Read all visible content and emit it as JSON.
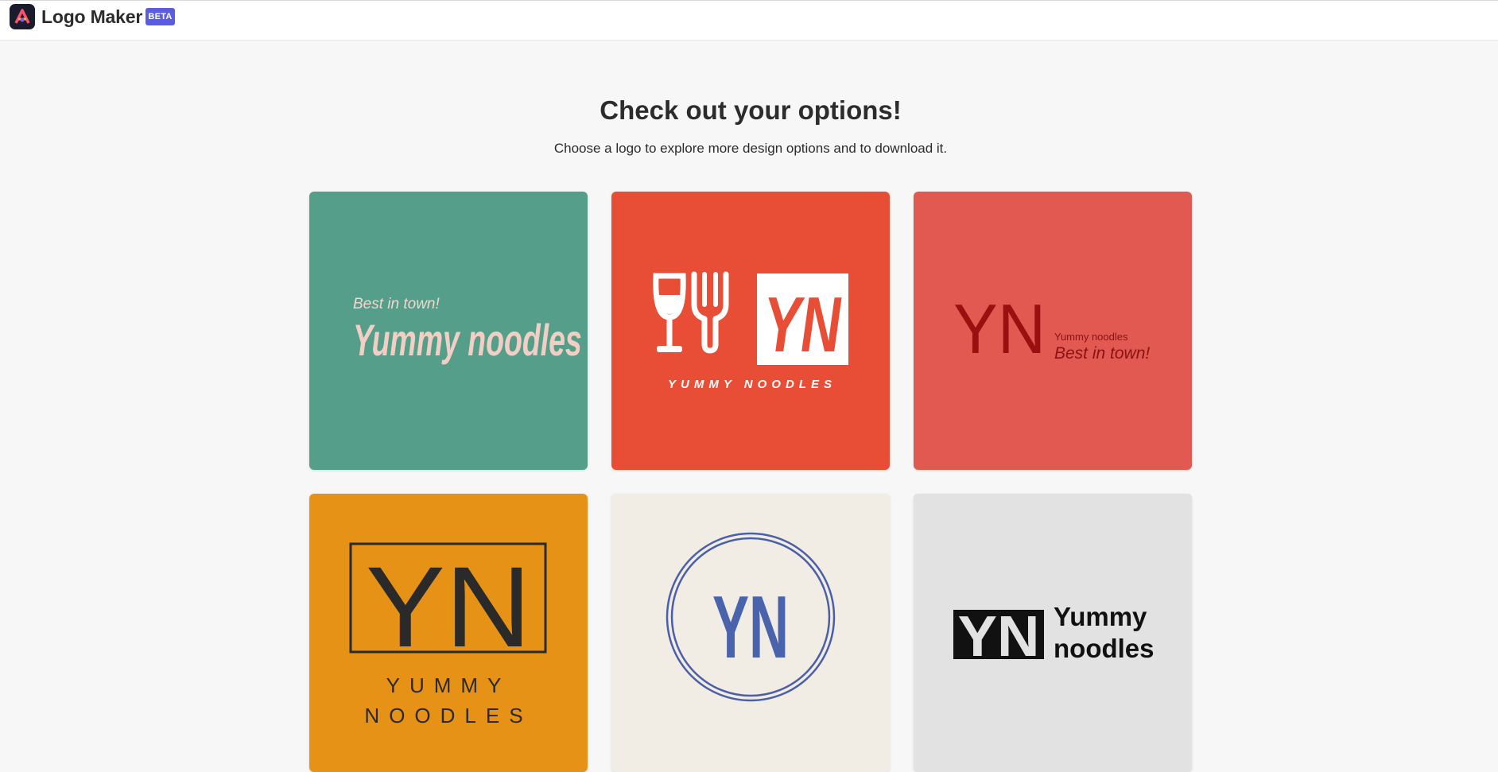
{
  "header": {
    "app_name": "Logo Maker",
    "badge": "BETA",
    "logo_icon": "adobe-express-icon"
  },
  "main": {
    "title": "Check out your options!",
    "subtitle": "Choose a logo to explore more design options and to download it."
  },
  "cards": [
    {
      "bg": "#559f8a",
      "tagline": "Best in town!",
      "name": "Yummy noodles"
    },
    {
      "bg": "#e84d36",
      "monogram": "YN",
      "name": "YUMMY NOODLES",
      "icons": [
        "wine-glass-icon",
        "fork-icon"
      ]
    },
    {
      "bg": "#e25952",
      "monogram": "YN",
      "name": "Yummy noodles",
      "tagline": "Best in town!"
    },
    {
      "bg": "#e69216",
      "monogram": "YN",
      "name_line1": "YUMMY",
      "name_line2": "NOODLES"
    },
    {
      "bg": "#f1ede4",
      "monogram": "YN"
    },
    {
      "bg": "#e2e2e2",
      "monogram": "YN",
      "name_line1": "Yummy",
      "name_line2": "noodles"
    }
  ]
}
